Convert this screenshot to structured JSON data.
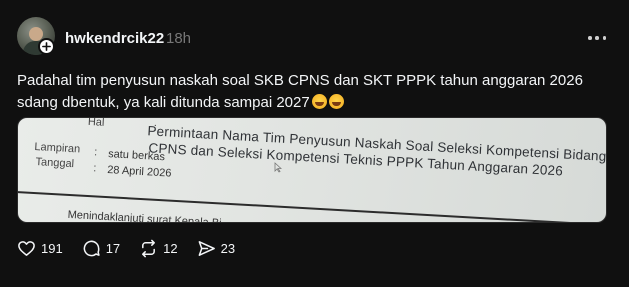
{
  "author": {
    "username": "hwkendrcik22",
    "time_ago": "18h",
    "avatar_icon": "avatar-photo",
    "follow_icon": "plus-icon"
  },
  "post": {
    "text": "Padahal tim penyusun naskah soal SKB CPNS dan SKT PPPK tahun anggaran 2026 sdang dbentuk, ya kali ditunda sampai 2027",
    "emojis": [
      "rolling-on-floor-laughing",
      "rolling-on-floor-laughing"
    ]
  },
  "image": {
    "line1": "Permintaan Nama Tim Penyusun Naskah Soal Seleksi Kompetensi Bidang",
    "line2": "CPNS dan Seleksi Kompetensi Teknis PPPK Tahun Anggaran 2026",
    "lampiran_label": "Lampiran",
    "lampiran_value": "satu berkas",
    "tanggal_label": "Tanggal",
    "tanggal_value": "28 April 2026",
    "colon": ":",
    "top_fragment": "Hal",
    "footer_fragment": "Menindaklanjuti surat Kepala Bi"
  },
  "actions": {
    "likes": "191",
    "replies": "17",
    "reposts": "12",
    "shares": "23"
  },
  "colors": {
    "background": "#101010",
    "text": "#f3f5f7",
    "muted": "#777777"
  }
}
